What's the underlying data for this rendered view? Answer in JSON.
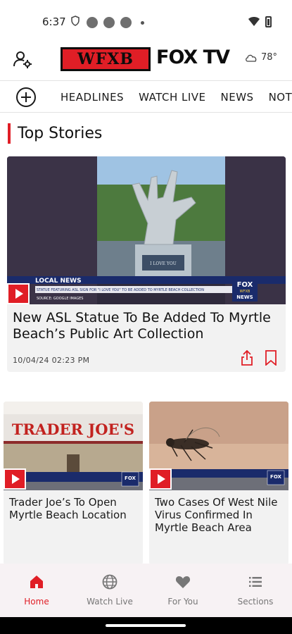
{
  "status_bar": {
    "time": "6:37"
  },
  "header": {
    "logo_callsign": "WFXB",
    "logo_brand": "FOX TV",
    "weather_temp": "78°",
    "weather_icon": "cloudy-icon"
  },
  "nav": {
    "tabs": [
      {
        "label": "HEADLINES"
      },
      {
        "label": "WATCH LIVE"
      },
      {
        "label": "NEWS"
      },
      {
        "label": "NOTICIAS"
      }
    ]
  },
  "section": {
    "title": "Top Stories"
  },
  "hero": {
    "title": "New ASL Statue To Be Added To Myrtle Beach’s Public Art Collection",
    "timestamp": "10/04/24 02:23 PM",
    "overlay_label": "LOCAL NEWS",
    "overlay_caption": "STATUE FEATURING ASL SIGN FOR \"I LOVE YOU\" TO BE ADDED TO MYRTLE BEACH COLLECTION",
    "overlay_source": "SOURCE: GOOGLE IMAGES",
    "plaque_text": "I LOVE YOU",
    "bug_text": "FOX",
    "bug_subtext": "WFXB",
    "bug_news": "NEWS"
  },
  "cards": [
    {
      "title": "Trader Joe’s To Open Myrtle Beach Location",
      "sign_text": "TRADER JOE'S",
      "bug_text": "FOX"
    },
    {
      "title": "Two Cases Of West Nile Virus Confirmed In Myrtle Beach Area",
      "bug_text": "FOX"
    }
  ],
  "tab_bar": {
    "items": [
      {
        "label": "Home",
        "icon": "home-icon",
        "active": true
      },
      {
        "label": "Watch Live",
        "icon": "globe-icon",
        "active": false
      },
      {
        "label": "For You",
        "icon": "heart-icon",
        "active": false
      },
      {
        "label": "Sections",
        "icon": "sections-icon",
        "active": false
      }
    ]
  },
  "colors": {
    "accent": "#e01e26",
    "text": "#1a1a1a",
    "card_bg": "#f2f2f2",
    "tab_bar_bg": "#f7f2f4"
  }
}
